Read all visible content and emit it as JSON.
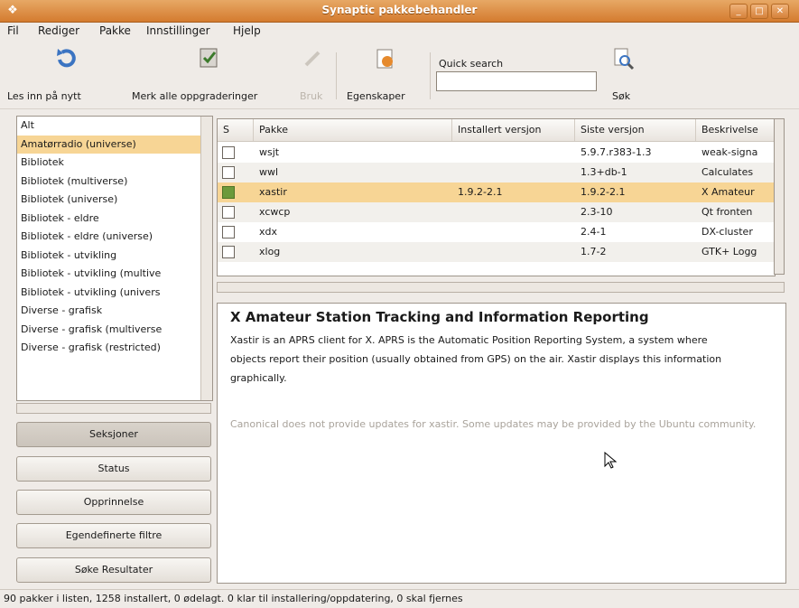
{
  "window": {
    "title": "Synaptic pakkebehandler",
    "app_icon": "synaptic-icon"
  },
  "menu": [
    "Fil",
    "Rediger",
    "Pakke",
    "Innstillinger",
    "Hjelp"
  ],
  "toolbar": {
    "reload_label": "Les inn på nytt",
    "upgrade_label": "Merk alle oppgraderinger",
    "apply_label": "Bruk",
    "properties_label": "Egenskaper",
    "search_label": "Søk",
    "quick_search_label": "Quick search",
    "quick_search_value": ""
  },
  "sections": [
    "Alt",
    "Amatørradio (universe)",
    "Bibliotek",
    "Bibliotek (multiverse)",
    "Bibliotek (universe)",
    "Bibliotek - eldre",
    "Bibliotek - eldre (universe)",
    "Bibliotek - utvikling",
    "Bibliotek - utvikling (multive",
    "Bibliotek - utvikling (univers",
    "Diverse - grafisk",
    "Diverse - grafisk (multiverse",
    "Diverse - grafisk (restricted)"
  ],
  "selected_section_index": 1,
  "filter_buttons": {
    "sections": "Seksjoner",
    "status": "Status",
    "origin": "Opprinnelse",
    "custom": "Egendefinerte filtre",
    "search_results": "Søke Resultater"
  },
  "table": {
    "headers": [
      "S",
      "Pakke",
      "Installert versjon",
      "Siste versjon",
      "Beskrivelse"
    ],
    "rows": [
      {
        "installed": false,
        "name": "wsjt",
        "installed_version": "",
        "latest_version": "5.9.7.r383-1.3",
        "description": "weak-signa"
      },
      {
        "installed": false,
        "name": "wwl",
        "installed_version": "",
        "latest_version": "1.3+db-1",
        "description": "Calculates"
      },
      {
        "installed": true,
        "name": "xastir",
        "installed_version": "1.9.2-2.1",
        "latest_version": "1.9.2-2.1",
        "description": "X Amateur"
      },
      {
        "installed": false,
        "name": "xcwcp",
        "installed_version": "",
        "latest_version": "2.3-10",
        "description": "Qt fronten"
      },
      {
        "installed": false,
        "name": "xdx",
        "installed_version": "",
        "latest_version": "2.4-1",
        "description": "DX-cluster"
      },
      {
        "installed": false,
        "name": "xlog",
        "installed_version": "",
        "latest_version": "1.7-2",
        "description": "GTK+ Logg"
      }
    ],
    "selected_row": 2
  },
  "details": {
    "title": "X Amateur Station Tracking and Information Reporting",
    "body": "Xastir is an APRS client for X. APRS is the Automatic Position Reporting System, a system where objects report their position (usually obtained from GPS) on the air. Xastir displays this information graphically.",
    "note": "Canonical does not provide updates for xastir. Some updates may be provided by the Ubuntu community."
  },
  "statusbar": "90 pakker i listen, 1258 installert, 0 ødelagt. 0 klar til installering/oppdatering, 0 skal fjernes",
  "colors": {
    "title_bar": "#d98a3e",
    "selection": "#f7d595",
    "installed_check": "#6c9a3b"
  }
}
